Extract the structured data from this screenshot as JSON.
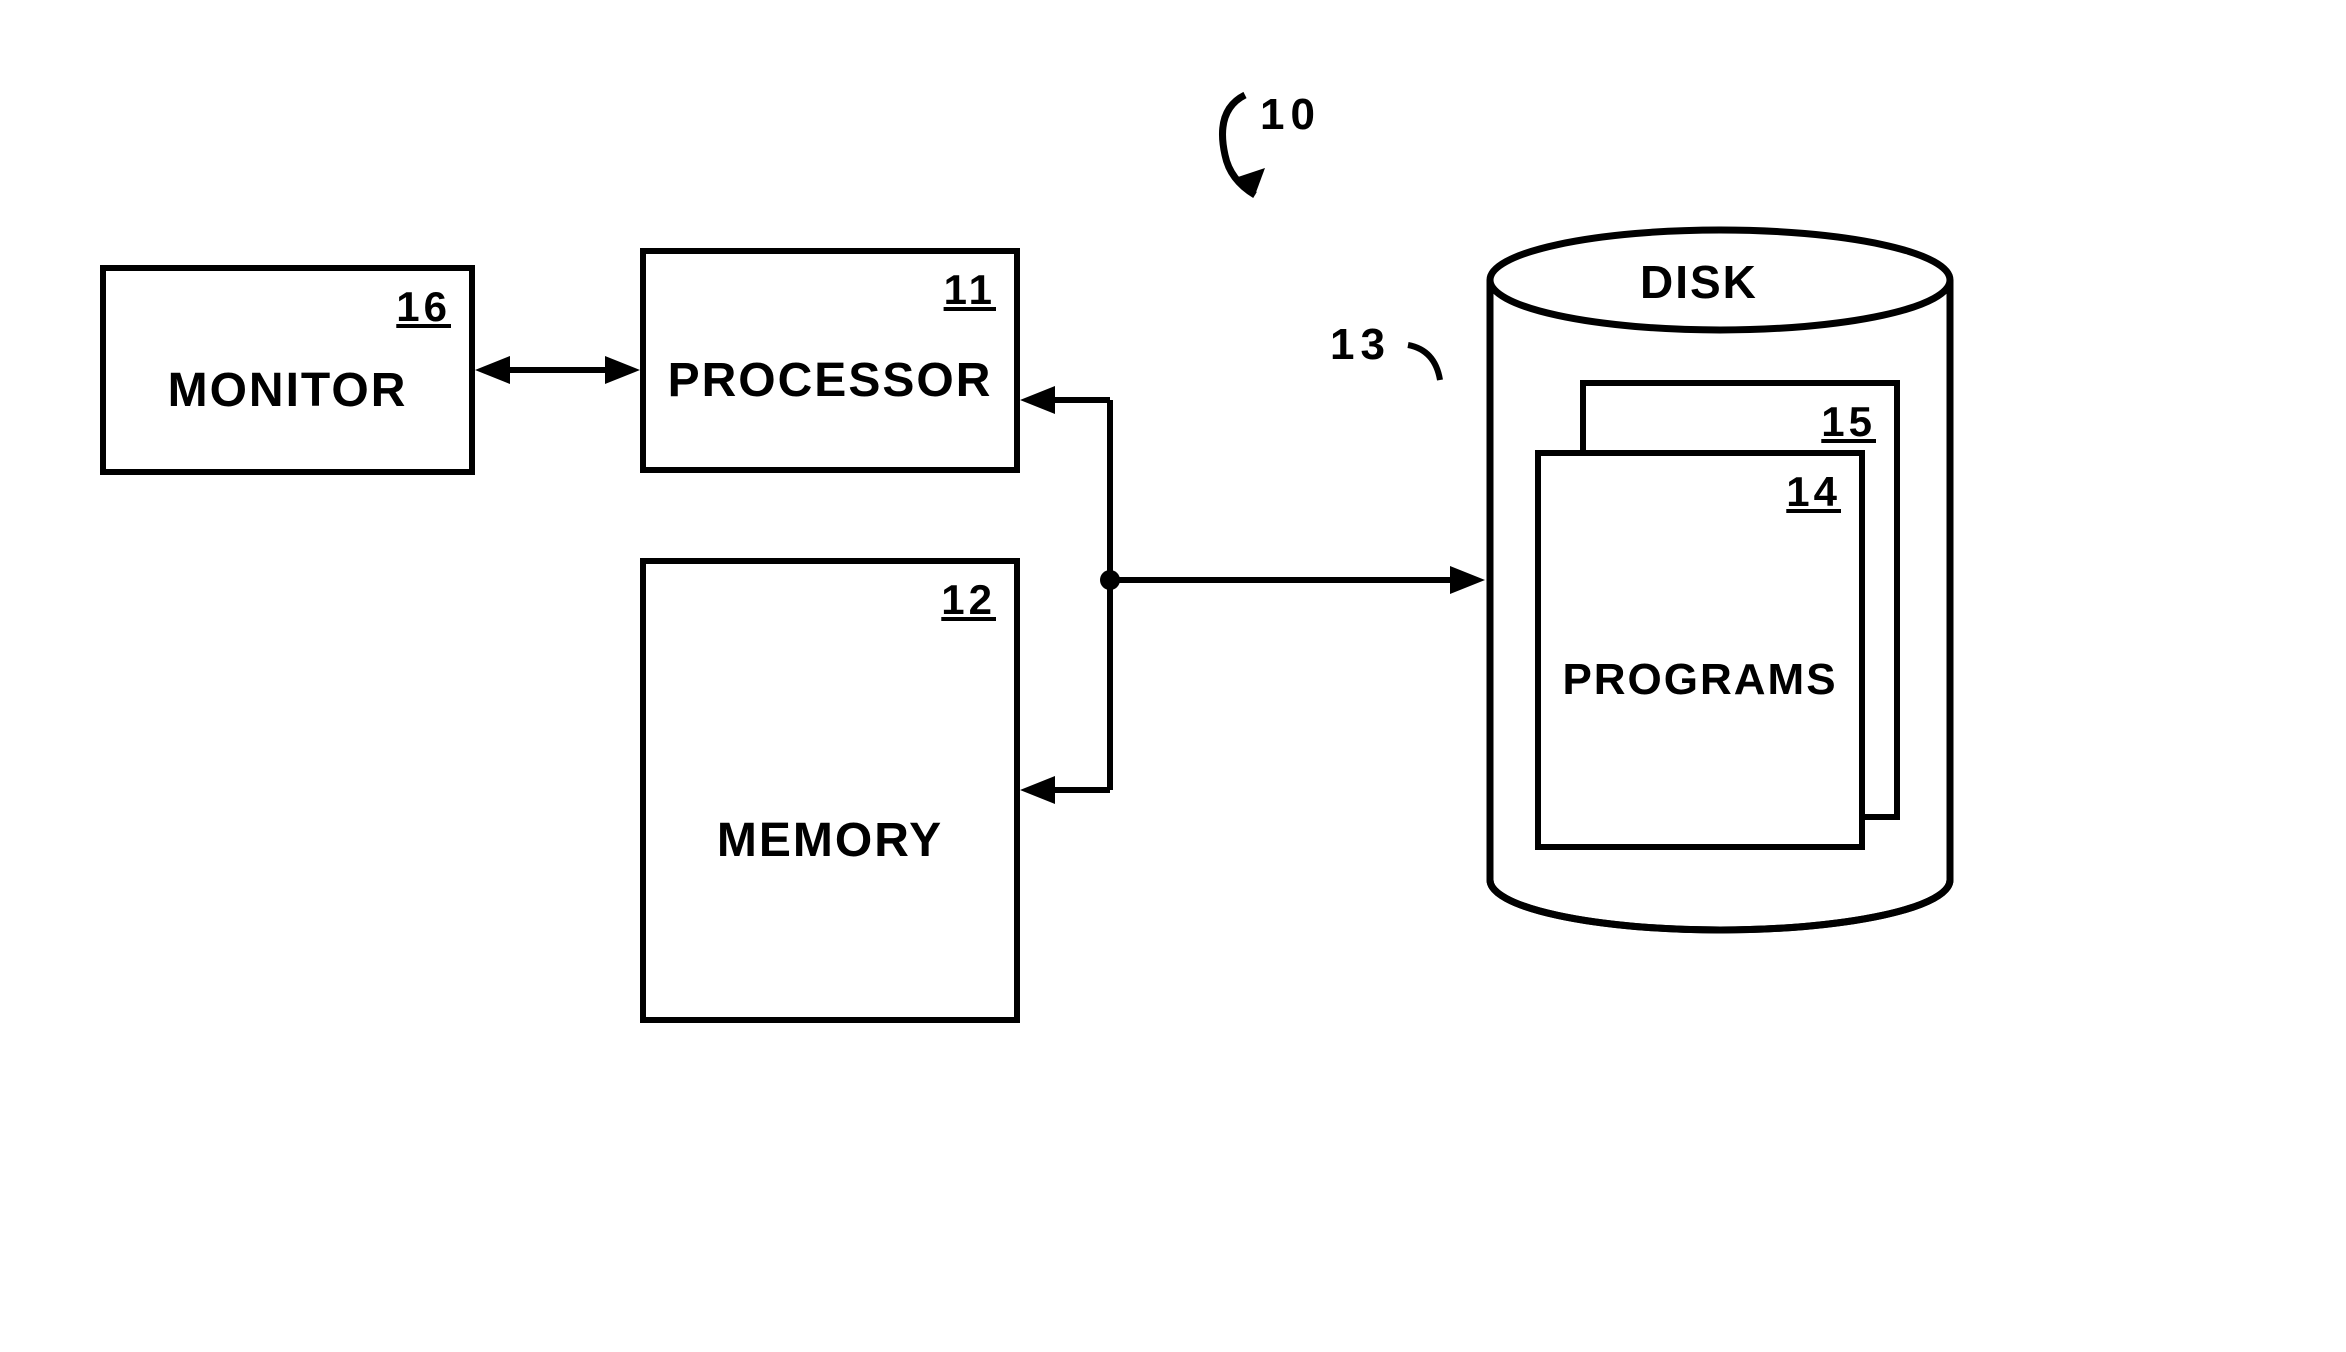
{
  "diagram": {
    "ref_main": "10",
    "ref_disk": "13",
    "monitor": {
      "num": "16",
      "label": "MONITOR"
    },
    "processor": {
      "num": "11",
      "label": "PROCESSOR"
    },
    "memory": {
      "num": "12",
      "label": "MEMORY"
    },
    "disk": {
      "label": "DISK"
    },
    "programs_back": {
      "num": "15"
    },
    "programs_front": {
      "num": "14",
      "label": "PROGRAMS"
    }
  }
}
